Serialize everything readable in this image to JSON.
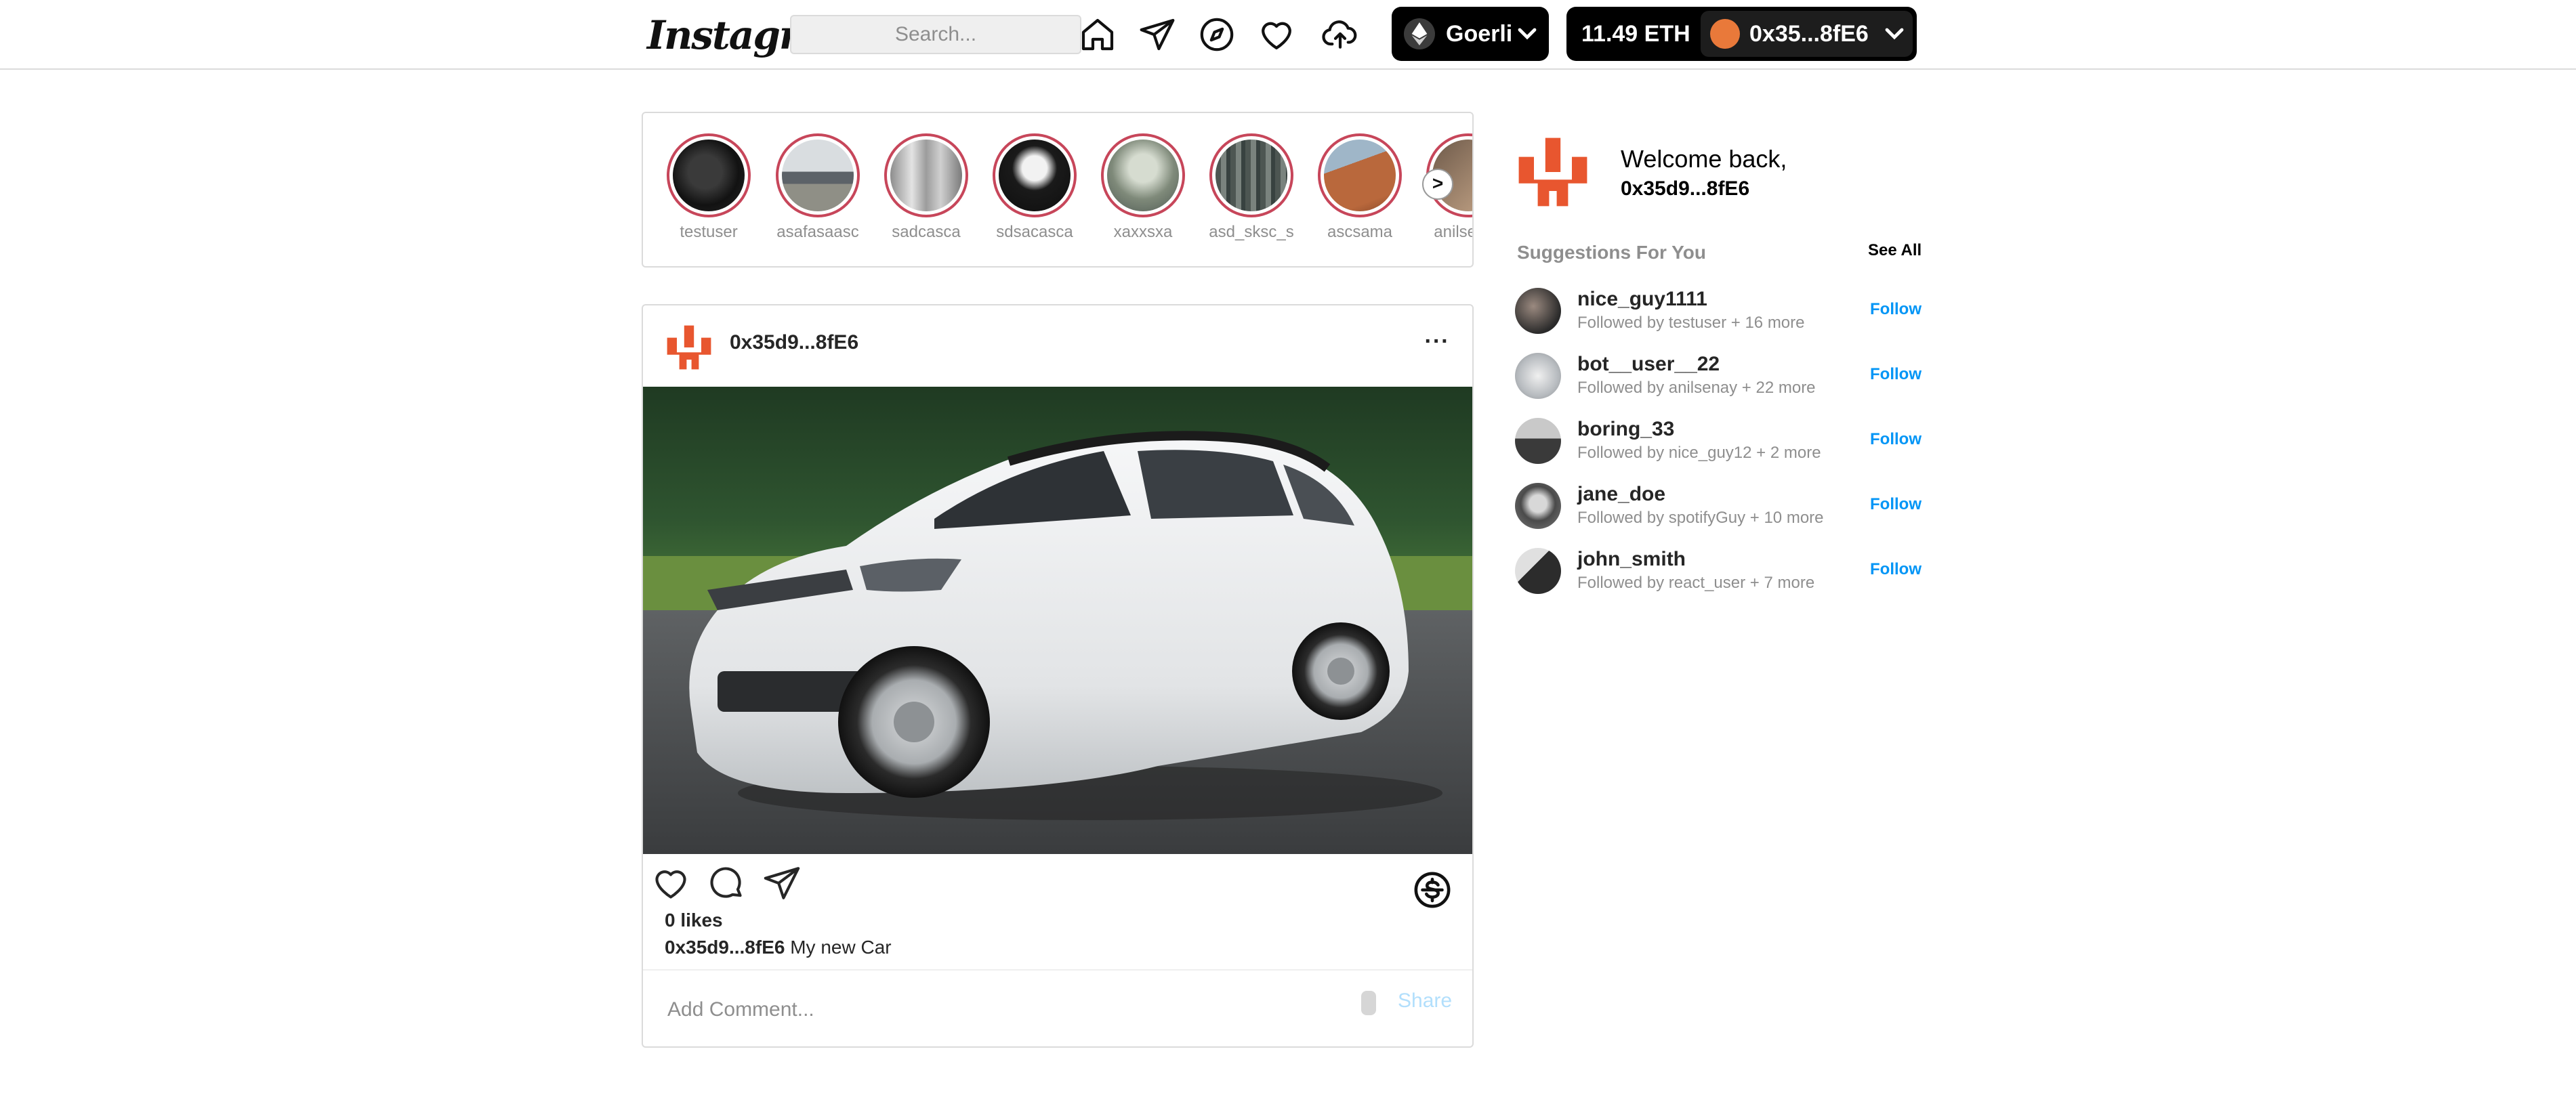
{
  "header": {
    "logo_text": "Instagram",
    "search_placeholder": "Search...",
    "network": "Goerli",
    "balance": "11.49 ETH",
    "account": "0x35...8fE6"
  },
  "stories": [
    {
      "username": "testuser"
    },
    {
      "username": "asafasaasc"
    },
    {
      "username": "sadcasca"
    },
    {
      "username": "sdsacasca"
    },
    {
      "username": "xaxxsxa"
    },
    {
      "username": "asd_sksc_s"
    },
    {
      "username": "ascsama"
    },
    {
      "username": "anilsenay"
    }
  ],
  "stories_next": ">",
  "post": {
    "username": "0x35d9...8fE6",
    "more": "···",
    "likes": "0 likes",
    "caption_user": "0x35d9...8fE6",
    "caption_text": "My new Car",
    "comment_placeholder": "Add Comment...",
    "share_label": "Share"
  },
  "sidebar": {
    "welcome": "Welcome back,",
    "username": "0x35d9...8fE6",
    "suggestions_title": "Suggestions For You",
    "see_all": "See All",
    "suggestions": [
      {
        "username": "nice_guy1111",
        "followed_by": "Followed by testuser + 16 more",
        "action": "Follow"
      },
      {
        "username": "bot__user__22",
        "followed_by": "Followed by anilsenay + 22 more",
        "action": "Follow"
      },
      {
        "username": "boring_33",
        "followed_by": "Followed by nice_guy12 + 2 more",
        "action": "Follow"
      },
      {
        "username": "jane_doe",
        "followed_by": "Followed by spotifyGuy + 10 more",
        "action": "Follow"
      },
      {
        "username": "john_smith",
        "followed_by": "Followed by react_user + 7 more",
        "action": "Follow"
      }
    ]
  },
  "colors": {
    "brand_orange": "#e8562f",
    "story_ring": "#c7465a",
    "follow_blue": "#0095f6"
  }
}
